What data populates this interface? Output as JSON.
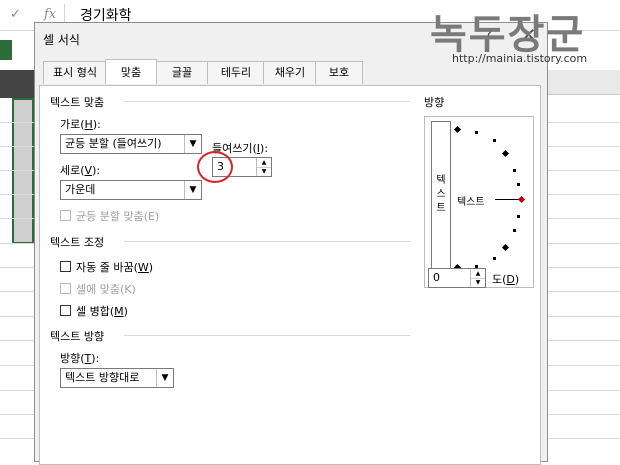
{
  "formula_bar": {
    "check_icon": "check-icon",
    "fx_label": "fx",
    "content": "경기화학"
  },
  "watermark": {
    "title": "녹두장군",
    "url": "http://mainia.tistory.com"
  },
  "dialog": {
    "title": "셀 서식",
    "help": "?",
    "close": "✕",
    "tabs": [
      {
        "label": "표시 형식",
        "active": false
      },
      {
        "label": "맞춤",
        "active": true
      },
      {
        "label": "글꼴",
        "active": false
      },
      {
        "label": "테두리",
        "active": false
      },
      {
        "label": "채우기",
        "active": false
      },
      {
        "label": "보호",
        "active": false
      }
    ],
    "text_align": {
      "section": "텍스트 맞춤",
      "horizontal_label": "가로(",
      "horizontal_key": "H",
      "horizontal_value": "균등 분할 (들여쓰기)",
      "indent_label": "들여쓰기(",
      "indent_key": "I",
      "indent_value": "3",
      "vertical_label": "세로(",
      "vertical_key": "V",
      "vertical_value": "가운데",
      "justify_distributed": "균등 분할 맞춤(E)",
      "justify_distributed_checked": false
    },
    "text_control": {
      "section": "텍스트 조정",
      "wrap_text": "자동 줄 바꿈(",
      "wrap_key": "W",
      "wrap_checked": false,
      "shrink_to_fit": "셀에 맞춤(K)",
      "shrink_checked": false,
      "merge": "셀 병합(",
      "merge_key": "M",
      "merge_checked": false
    },
    "direction": {
      "section": "텍스트 방향",
      "label": "방향(",
      "key": "T",
      "value": "텍스트 방향대로"
    },
    "orientation": {
      "section": "방향",
      "vertical_text": [
        "텍",
        "스",
        "트"
      ],
      "dial_text": "텍스트",
      "degrees_value": "0",
      "degrees_label": "도(",
      "degrees_key": "D",
      "degrees_accent": "#c00000"
    }
  }
}
